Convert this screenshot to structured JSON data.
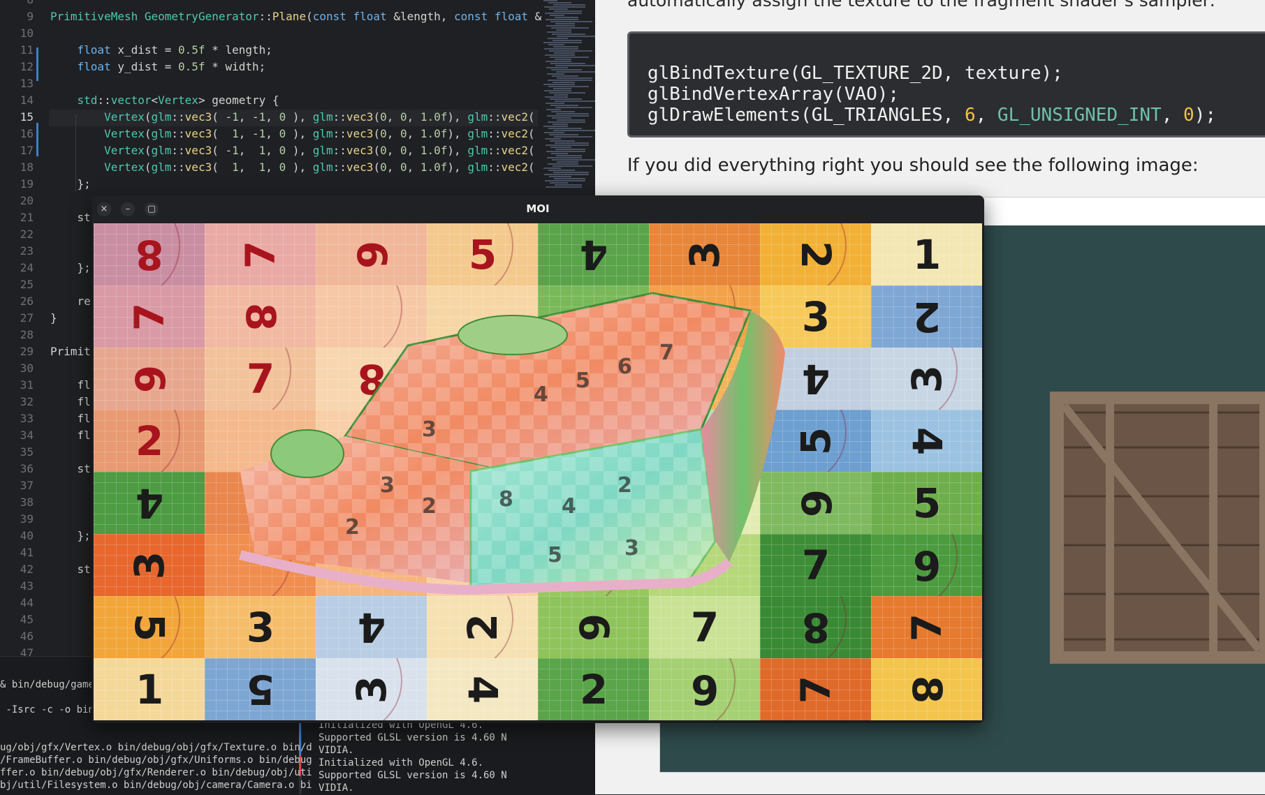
{
  "editor": {
    "line_numbers": [
      "8",
      "9",
      "10",
      "11",
      "12",
      "13",
      "14",
      "15",
      "16",
      "17",
      "18",
      "19",
      "20",
      "21",
      "22",
      "23",
      "24",
      "25",
      "26",
      "27",
      "28",
      "29",
      "30",
      "31",
      "32",
      "33",
      "34",
      "35",
      "36",
      "37",
      "38",
      "39",
      "40",
      "41",
      "42",
      "43",
      "44",
      "45",
      "46",
      "47"
    ],
    "current_line": "15",
    "lines": [
      "PrimitiveMesh GeometryGenerator::Plane(const float &length, const float &",
      "",
      "    float x_dist = 0.5f * length;",
      "    float y_dist = 0.5f * width;",
      "",
      "    std::vector<Vertex> geometry {",
      "        Vertex(glm::vec3( -1, -1, 0 ), glm::vec3(0, 0, 1.0f), glm::vec2(",
      "        Vertex(glm::vec3(  1, -1, 0 ), glm::vec3(0, 0, 1.0f), glm::vec2(",
      "        Vertex(glm::vec3( -1,  1, 0 ), glm::vec3(0, 0, 1.0f), glm::vec2(",
      "        Vertex(glm::vec3(  1,  1, 0 ), glm::vec3(0, 0, 1.0f), glm::vec2(",
      "    };",
      "",
      "    st",
      "",
      "",
      "    };",
      "",
      "    re",
      "}",
      "",
      "Primit",
      "",
      "    fl",
      "    fl",
      "    fl",
      "    fl",
      "",
      "    st",
      "",
      "",
      "",
      "    };",
      "",
      "    st"
    ]
  },
  "terminal": {
    "left_lines": [
      "& bin/debug/game",
      "",
      " -Isrc -c -o bin",
      "",
      "",
      "ug/obj/gfx/Vertex.o bin/debug/obj/gfx/Texture.o bin/d",
      "/FrameBuffer.o bin/debug/obj/gfx/Uniforms.o bin/debug",
      "ffer.o bin/debug/obj/gfx/Renderer.o bin/debug/obj/uti",
      "bj/util/Filesystem.o bin/debug/obj/camera/Camera.o bi"
    ],
    "right_lines": [
      "Initialized with OpenGL 4.6.",
      "Supported GLSL version is 4.60 N",
      "VIDIA.",
      "Initialized with OpenGL 4.6.",
      "Supported GLSL version is 4.60 N",
      "VIDIA."
    ]
  },
  "doc": {
    "intro_text": "automatically assign the texture to the fragment shader's sampler:",
    "code": {
      "line1": "glBindTexture(GL_TEXTURE_2D, texture);",
      "line2": "glBindVertexArray(VAO);",
      "line3_prefix": "glDrawElements(GL_TRIANGLES, ",
      "line3_count": "6",
      "line3_sep": ", ",
      "line3_const": "GL_UNSIGNED_INT",
      "line3_sep2": ", ",
      "line3_zero": "0",
      "line3_suffix": ");"
    },
    "after_text": "If you did everything right you should see the following image:"
  },
  "moi_window": {
    "title": "MOI",
    "close_icon": "×",
    "minimize_icon": "–",
    "maximize_icon": "▢",
    "grid": {
      "rows": [
        {
          "colors": [
            "#c98ea2",
            "#e9a9a5",
            "#f0b79a",
            "#f4c98e",
            "#5aa34a",
            "#e8863a",
            "#f2b136",
            "#f3e7b4"
          ],
          "nums": [
            "8",
            "7",
            "6",
            "5",
            "4",
            "3",
            "2",
            "1"
          ]
        },
        {
          "colors": [
            "#d99aa5",
            "#f1b9a2",
            "#f6c8a6",
            "#f6d6a4",
            "#7ab95a",
            "#f3a24a",
            "#f6c95a",
            "#7fa7d4"
          ],
          "nums": [
            "7",
            "8",
            "",
            "",
            "",
            "",
            "3",
            "2"
          ]
        },
        {
          "colors": [
            "#e7a78f",
            "#f2c29b",
            "#f7d6b0",
            "#f2d0a8",
            "#95c66c",
            "#f5b45a",
            "#c2cfe0",
            "#c8d6e4"
          ],
          "nums": [
            "6",
            "7",
            "8",
            "",
            "",
            "",
            "4",
            "3"
          ]
        },
        {
          "colors": [
            "#e89a72",
            "#f4b98c",
            "#f8cfa8",
            "#f5d9b5",
            "#b3d78c",
            "#b6dbb8",
            "#6d9fd0",
            "#9cc2e2"
          ],
          "nums": [
            "2",
            "",
            "",
            "",
            "",
            "",
            "5",
            "4"
          ]
        },
        {
          "colors": [
            "#4d9b43",
            "#e9874e",
            "#f2a77a",
            "#f8c9a2",
            "#d8e9a8",
            "#e4ecb4",
            "#7fb960",
            "#6fae4d"
          ],
          "nums": [
            "4",
            "",
            "",
            "",
            "",
            "",
            "6",
            "5"
          ]
        },
        {
          "colors": [
            "#e7672d",
            "#f08e4f",
            "#f7b57e",
            "#f9d0a6",
            "#97c85f",
            "#b6d87b",
            "#3e8d37",
            "#4c9b3f"
          ],
          "nums": [
            "3",
            "",
            "",
            "",
            "",
            "",
            "7",
            "6"
          ]
        },
        {
          "colors": [
            "#f2a63a",
            "#f5bd6a",
            "#b9cde4",
            "#f5e1b2",
            "#8fc45c",
            "#c9e295",
            "#3a8a35",
            "#e67a2e"
          ],
          "nums": [
            "5",
            "3",
            "4",
            "2",
            "6",
            "7",
            "8",
            "7"
          ]
        },
        {
          "colors": [
            "#f4d89a",
            "#7ea6d3",
            "#d9e2ec",
            "#f3e8c2",
            "#5aa44a",
            "#a5d073",
            "#e06a2a",
            "#f3c54d"
          ],
          "nums": [
            "1",
            "5",
            "3",
            "4",
            "2",
            "6",
            "7",
            "8"
          ]
        }
      ]
    }
  },
  "colors": {
    "accent_blue": "#3f7fc8",
    "diff_red": "#e04848",
    "doc_code_bg": "#2b2d31",
    "doc_frame_bg": "#2f4a4b"
  }
}
